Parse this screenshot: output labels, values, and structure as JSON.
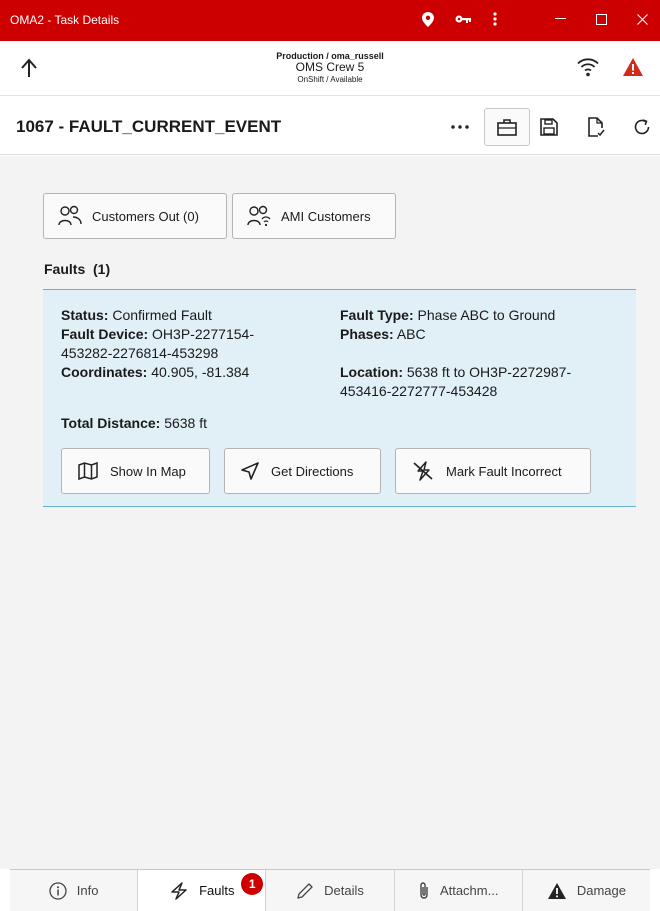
{
  "window": {
    "title": "OMA2 - Task Details",
    "accent_color": "#cc0000",
    "icons": [
      "location-pin-icon",
      "key-icon",
      "more-vertical-icon"
    ],
    "controls": [
      "minimize",
      "maximize",
      "close"
    ]
  },
  "header": {
    "environment": "Production / oma_russell",
    "crew": "OMS Crew 5",
    "status": "OnShift / Available"
  },
  "task": {
    "title": "1067 - FAULT_CURRENT_EVENT",
    "tools": [
      "more-horizontal-icon",
      "briefcase-icon",
      "save-icon",
      "document-check-icon",
      "refresh-icon"
    ]
  },
  "actions": {
    "customers_out": "Customers Out (0)",
    "ami_customers": "AMI Customers"
  },
  "faults_section": {
    "label": "Faults",
    "count": "(1)"
  },
  "fault": {
    "status_label": "Status:",
    "status_value": "Confirmed Fault",
    "fault_type_label": "Fault Type:",
    "fault_type_value": "Phase ABC to Ground",
    "device_label": "Fault Device:",
    "device_value_line1": "OH3P-2277154-",
    "device_value_line2": "453282-2276814-453298",
    "phases_label": "Phases:",
    "phases_value": "ABC",
    "coordinates_label": "Coordinates:",
    "coordinates_value": "40.905, -81.384",
    "location_label": "Location:",
    "location_value_line1": "5638 ft to OH3P-2272987-",
    "location_value_line2": "453416-2272777-453428",
    "total_distance_label": "Total Distance:",
    "total_distance_value": "5638 ft",
    "buttons": {
      "show_in_map": "Show In Map",
      "get_directions": "Get Directions",
      "mark_incorrect": "Mark Fault Incorrect"
    },
    "card_color": "#e1eff6",
    "border_color": "#6ab0cf"
  },
  "tabs": [
    {
      "label": "Info",
      "icon": "info-icon"
    },
    {
      "label": "Faults",
      "icon": "lightning-icon",
      "badge": "1"
    },
    {
      "label": "Details",
      "icon": "pencil-icon"
    },
    {
      "label": "Attachm...",
      "icon": "paperclip-icon"
    },
    {
      "label": "Damage",
      "icon": "warning-triangle-icon"
    }
  ],
  "active_tab": "Faults"
}
